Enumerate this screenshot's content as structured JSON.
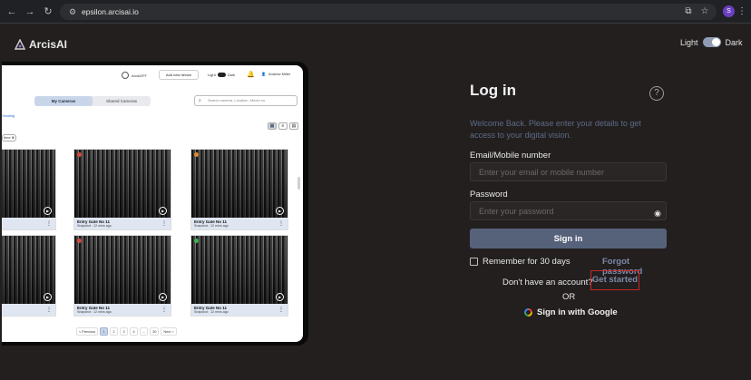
{
  "browser": {
    "url": "epsilon.arcisai.io",
    "profile_initial": "S"
  },
  "brand": {
    "name": "ArcisAI"
  },
  "theme": {
    "light_label": "Light",
    "dark_label": "Dark"
  },
  "preview": {
    "gpt_label": "ArcisGPT",
    "add_device_label": "Add new device",
    "theme_light": "Light",
    "theme_dark": "Dark",
    "user_name": "Andrew Miller",
    "tabs": [
      "My Cameras",
      "Shared Cameras"
    ],
    "search_placeholder": "Search camera, Location, Model no.",
    "link_text": "Vicating",
    "chip_text": "time",
    "cards": [
      {
        "title": "Entry Gate No 11",
        "sub": "Snapshot : 12 mins ago",
        "status_color": "#d64a3a"
      },
      {
        "title": "Entry Gate No 11",
        "sub": "Snapshot : 12 mins ago",
        "status_color": "#d64a3a"
      },
      {
        "title": "Entry Gate No 11",
        "sub": "Snapshot : 12 mins ago",
        "status_color": "#e08a2c"
      },
      {
        "title": "Entry Gate No 11",
        "sub": "Snapshot : 12 mins ago",
        "status_color": "#d64a3a"
      },
      {
        "title": "Entry Gate No 11",
        "sub": "Snapshot : 12 mins ago",
        "status_color": "#d64a3a"
      },
      {
        "title": "Entry Gate No 11",
        "sub": "Snapshot : 12 mins ago",
        "status_color": "#3fb24f"
      }
    ],
    "pager": {
      "prev": "< Previous",
      "pages": [
        "1",
        "2",
        "3",
        "4",
        "...",
        "30"
      ],
      "next": "Next >"
    }
  },
  "login": {
    "title": "Log in",
    "welcome": "Welcome Back. Please enter your details to get access to your digital vision.",
    "email_label": "Email/Mobile number",
    "email_placeholder": "Enter your email or mobile number",
    "password_label": "Password",
    "password_placeholder": "Enter your password",
    "signin_label": "Sign in",
    "remember_label": "Remember for 30 days",
    "forgot_label": "Forgot password",
    "no_account_text": "Don't have an account?",
    "get_started_label": "Get started",
    "or_text": "OR",
    "google_label": "Sign in with Google"
  },
  "colors": {
    "background": "#231f1f",
    "accent_button": "#56627a",
    "link": "#7c8aa8",
    "highlight_box": "#c62828"
  }
}
